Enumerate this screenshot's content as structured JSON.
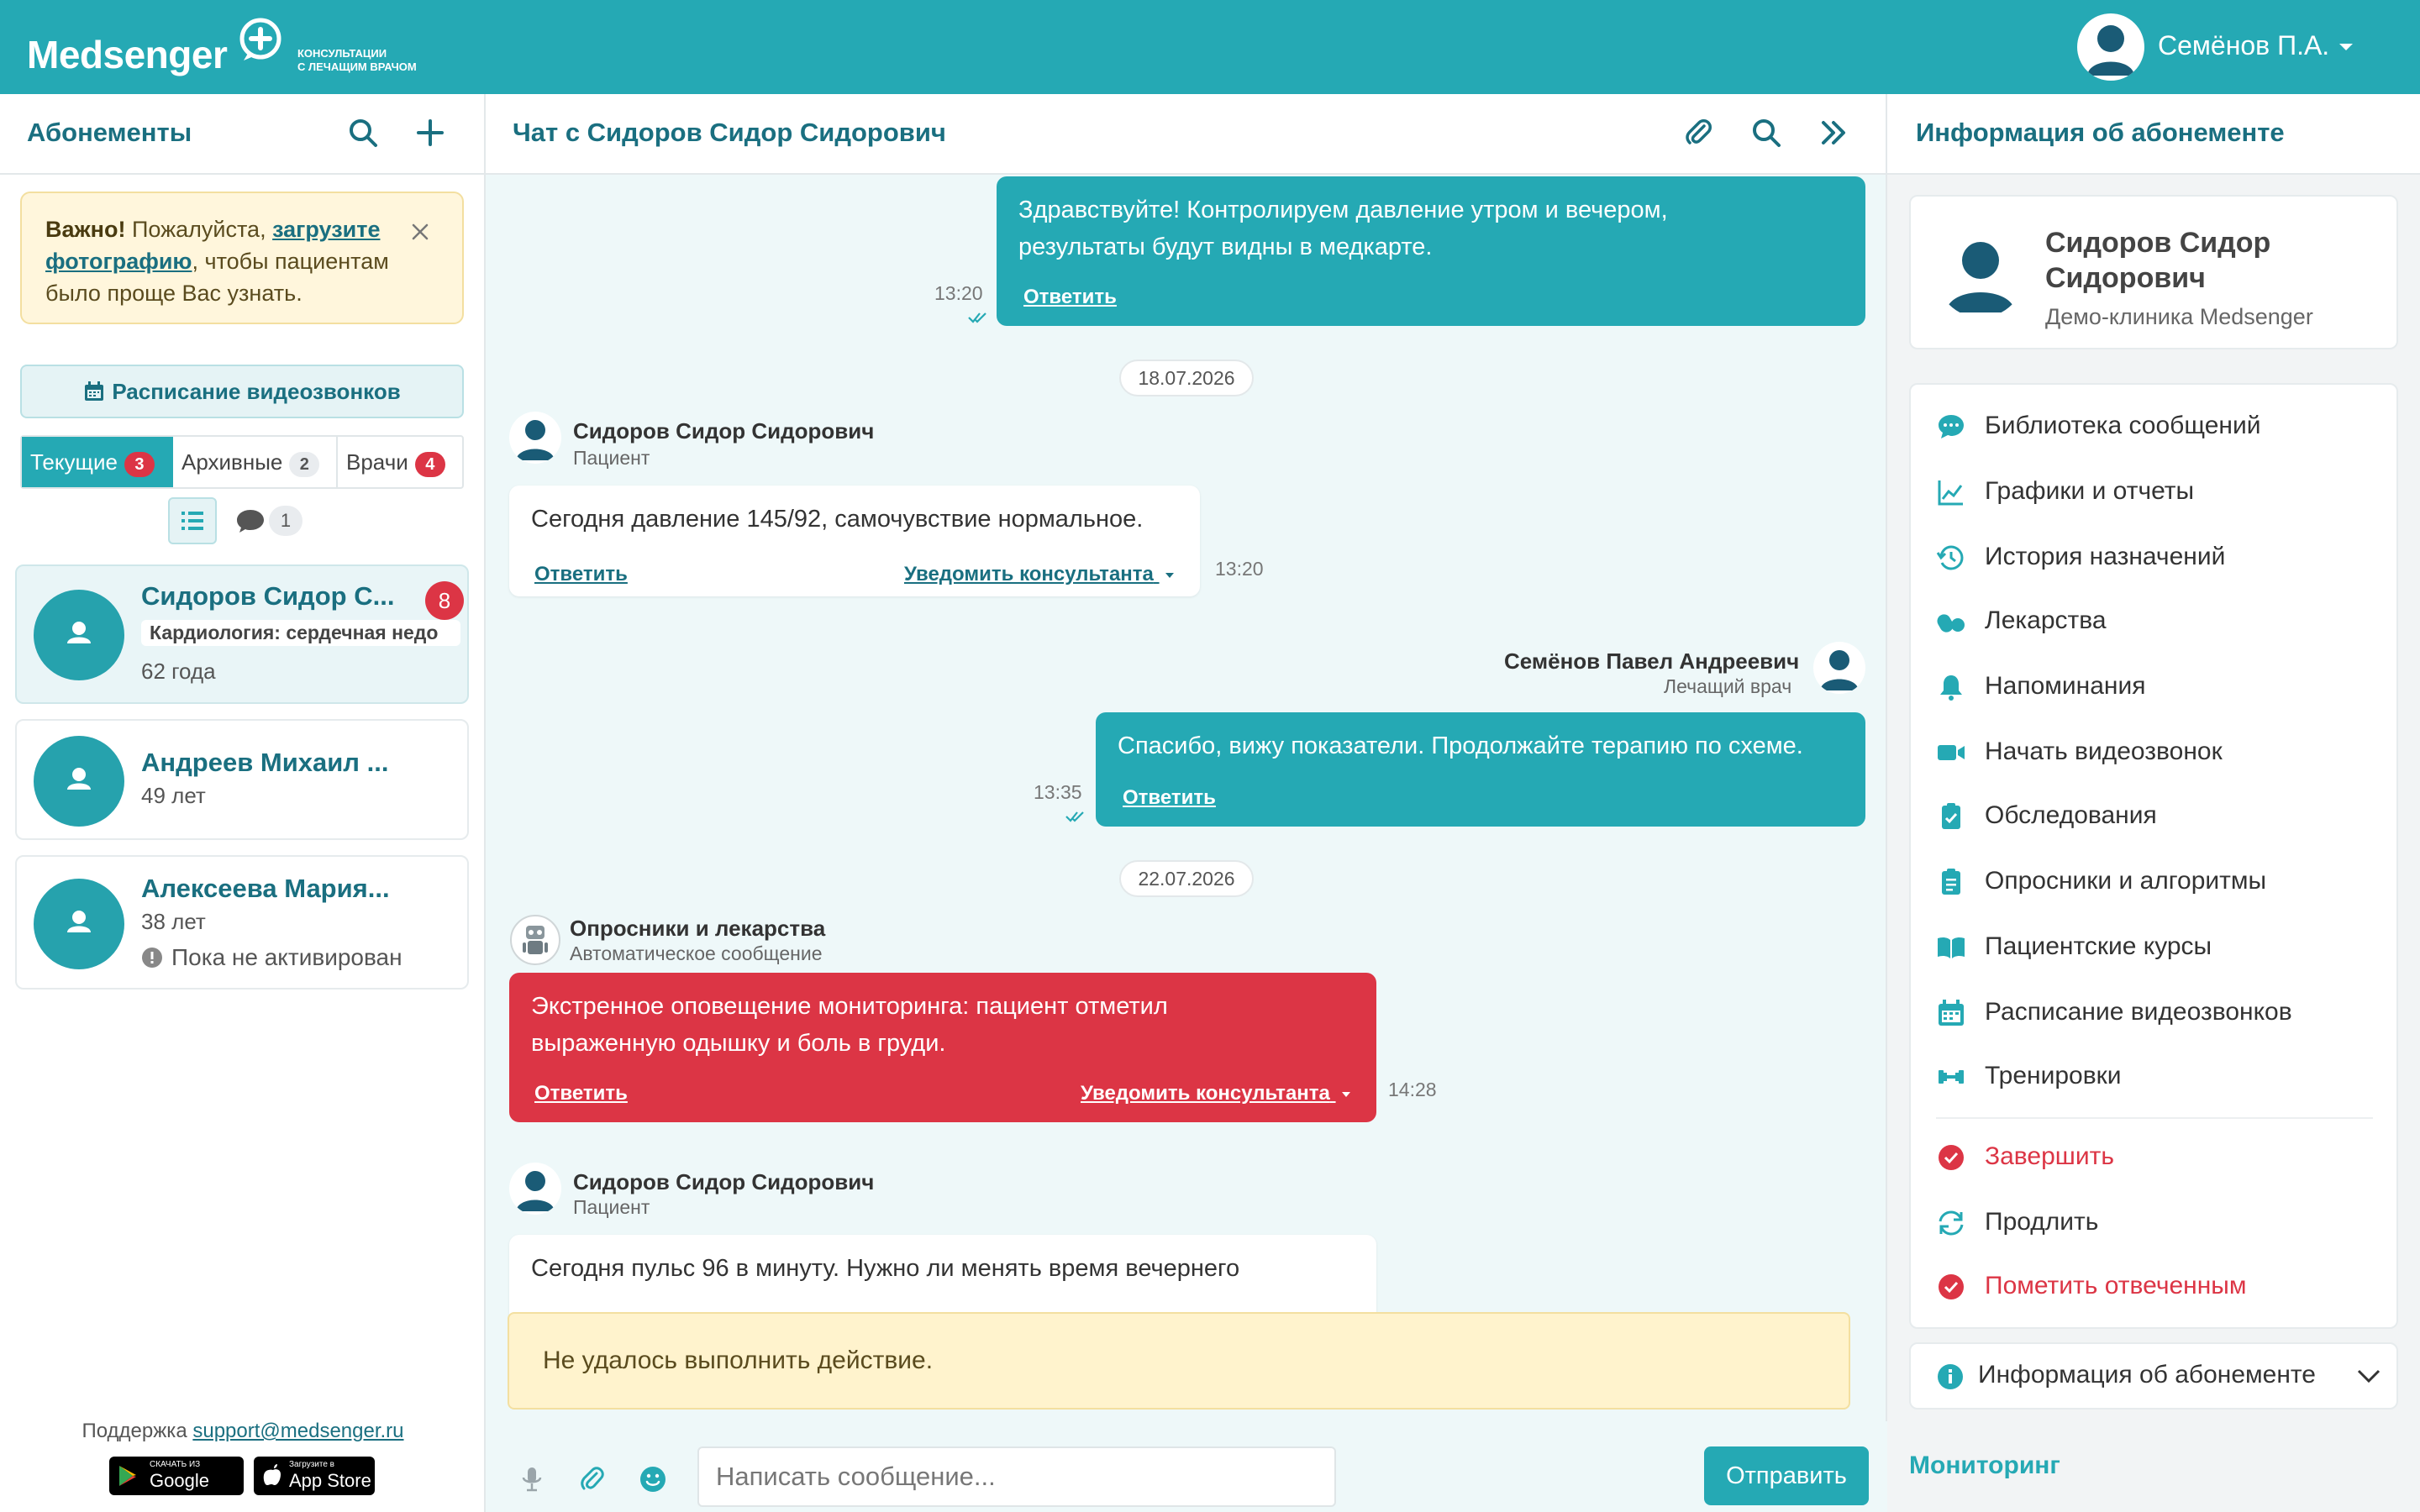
{
  "app": {
    "logo": "Medsenger",
    "logo_sub1": "КОНСУЛЬТАЦИИ",
    "logo_sub2": "С ЛЕЧАЩИМ ВРАЧОМ",
    "user_name": "Семёнов П.А."
  },
  "colors": {
    "brand": "#25a9b4",
    "brand_dark": "#1a6f80",
    "danger": "#dc3545",
    "warning_bg": "#fff3cd"
  },
  "left": {
    "title": "Абонементы",
    "warning": {
      "bold": "Важно!",
      "t1": " Пожалуйста, ",
      "link1": "загрузите",
      "link2": "фотографию",
      "t2": ", чтобы пациентам",
      "t3": "было проще Вас узнать."
    },
    "schedule_button": "Расписание видеозвонков",
    "tabs": [
      {
        "label": "Текущие",
        "count": "3"
      },
      {
        "label": "Архивные",
        "count": "2"
      },
      {
        "label": "Врачи",
        "count": "4"
      }
    ],
    "chat_filter_count": "1",
    "patients": [
      {
        "name": "Сидоров Сидор С...",
        "tag": "Кардиология: сердечная недо",
        "age": "62 года",
        "unread": "8"
      },
      {
        "name": "Андреев Михаил ...",
        "age": "49 лет"
      },
      {
        "name": "Алексеева Мария...",
        "age": "38 лет",
        "status": "Пока не активирован"
      }
    ],
    "support_label": "Поддержка ",
    "support_email": "support@medsenger.ru",
    "google_small": "СКАЧАТЬ ИЗ",
    "google_big": "Google Play",
    "apple_small": "Загрузите в",
    "apple_big": "App Store"
  },
  "chat": {
    "title": "Чат с Сидоров Сидор Сидорович",
    "messages": {
      "m1": {
        "line1": "Здравствуйте! Контролируем давление утром и вечером,",
        "line2": "результаты будут видны в медкарте.",
        "reply": "Ответить",
        "time": "13:20"
      },
      "date1": "18.07.2026",
      "m2": {
        "sender": "Сидоров Сидор Сидорович",
        "role": "Пациент",
        "text": "Сегодня давление 145/92, самочувствие нормальное.",
        "reply": "Ответить",
        "notify": "Уведомить консультанта",
        "time": "13:20"
      },
      "m3": {
        "sender": "Семёнов Павел Андреевич",
        "role": "Лечащий врач",
        "text": "Спасибо, вижу показатели. Продолжайте терапию по схеме.",
        "reply": "Ответить",
        "time": "13:35"
      },
      "date2": "22.07.2026",
      "m4": {
        "sender": "Опросники и лекарства",
        "role": "Автоматическое сообщение",
        "line1": "Экстренное оповещение мониторинга: пациент отметил",
        "line2": "выраженную одышку и боль в груди.",
        "reply": "Ответить",
        "notify": "Уведомить консультанта",
        "time": "14:28"
      },
      "m5": {
        "sender": "Сидоров Сидор Сидорович",
        "role": "Пациент",
        "text": "Сегодня пульс 96 в минуту. Нужно ли менять время вечернего"
      }
    },
    "alert": "Не удалось выполнить действие.",
    "input_placeholder": "Написать сообщение...",
    "send": "Отправить"
  },
  "right": {
    "title": "Информация об абонементе",
    "patient_name_1": "Сидоров Сидор",
    "patient_name_2": "Сидорович",
    "clinic": "Демо-клиника Medsenger",
    "menu": [
      "Библиотека сообщений",
      "Графики и отчеты",
      "История назначений",
      "Лекарства",
      "Напоминания",
      "Начать видеозвонок",
      "Обследования",
      "Опросники и алгоритмы",
      "Пациентские курсы",
      "Расписание видеозвонков",
      "Тренировки"
    ],
    "actions": [
      "Завершить",
      "Продлить",
      "Пометить отвеченным"
    ],
    "info_accordion": "Информация об абонементе",
    "monitoring": "Мониторинг"
  }
}
